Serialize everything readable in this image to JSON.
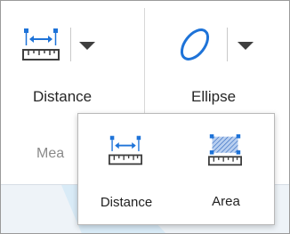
{
  "ribbon": {
    "distance_button": {
      "label": "Distance",
      "icon": "distance-ruler-icon"
    },
    "ellipse_button": {
      "label": "Ellipse",
      "icon": "ellipse-icon"
    },
    "group_label": "Mea",
    "dropdown_icon": "chevron-down-icon"
  },
  "dropdown": {
    "items": [
      {
        "label": "Distance",
        "icon": "distance-ruler-icon"
      },
      {
        "label": "Area",
        "icon": "area-ruler-icon"
      }
    ]
  },
  "colors": {
    "accent": "#1e73d8",
    "icon_dark": "#3f3f3f",
    "area_fill": "#8db3e8"
  }
}
